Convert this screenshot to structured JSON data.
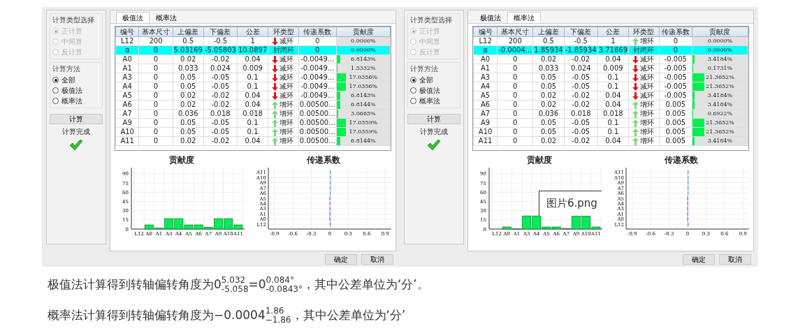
{
  "screenshots": [
    {
      "sidebar": {
        "groups": [
          {
            "title": "计算类型选择",
            "options": [
              {
                "label": "正计算",
                "selected": true,
                "disabled": true
              },
              {
                "label": "中间算",
                "selected": false,
                "disabled": true
              },
              {
                "label": "反计算",
                "selected": false,
                "disabled": true
              }
            ]
          },
          {
            "title": "计算方法",
            "options": [
              {
                "label": "全部",
                "selected": true,
                "disabled": false
              },
              {
                "label": "极值法",
                "selected": false,
                "disabled": false
              },
              {
                "label": "概率法",
                "selected": false,
                "disabled": false
              }
            ]
          }
        ],
        "button": "计算",
        "status": "计算完成",
        "done": true
      },
      "tabs": [
        {
          "label": "极值法",
          "selected": true
        },
        {
          "label": "概率法",
          "selected": false
        }
      ],
      "table": {
        "columns": [
          "编号",
          "基本尺寸",
          "上偏差",
          "下偏差",
          "公差",
          "环类型",
          "传递系数",
          "贡献度"
        ],
        "rows": [
          {
            "cells": [
              "L12",
              "200",
              "0.5",
              "-0.5",
              "1"
            ],
            "kind": "decrease",
            "ring_type": "减环",
            "coefficient": "0",
            "contribution": "0.0000%"
          },
          {
            "cells": [
              "α",
              "0",
              "5.03169",
              "-5.05803",
              "10.0897"
            ],
            "kind": "closed",
            "ring_type": "封闭环",
            "coefficient": "0",
            "contribution": "0.0000%"
          },
          {
            "cells": [
              "A0",
              "0",
              "0.02",
              "-0.02",
              "0.04"
            ],
            "kind": "decrease",
            "ring_type": "减环",
            "coefficient": "-0.0049...",
            "contribution": "6.8143%",
            "level": 0.068
          },
          {
            "cells": [
              "A1",
              "0",
              "0.033",
              "0.024",
              "0.009"
            ],
            "kind": "decrease",
            "ring_type": "减环",
            "coefficient": "-0.0049...",
            "contribution": "1.5332%",
            "level": 0.015
          },
          {
            "cells": [
              "A3",
              "0",
              "0.05",
              "-0.05",
              "0.1"
            ],
            "kind": "decrease",
            "ring_type": "减环",
            "coefficient": "-0.0049...",
            "contribution": "17.0356%",
            "level": 0.17
          },
          {
            "cells": [
              "A4",
              "0",
              "0.05",
              "-0.05",
              "0.1"
            ],
            "kind": "decrease",
            "ring_type": "减环",
            "coefficient": "-0.0049...",
            "contribution": "17.0356%",
            "level": 0.17
          },
          {
            "cells": [
              "A5",
              "0",
              "0.02",
              "-0.02",
              "0.04"
            ],
            "kind": "decrease",
            "ring_type": "减环",
            "coefficient": "-0.0049...",
            "contribution": "6.8143%",
            "level": 0.068
          },
          {
            "cells": [
              "A6",
              "0",
              "0.02",
              "-0.02",
              "0.04"
            ],
            "kind": "increase",
            "ring_type": "增环",
            "coefficient": "0.00500...",
            "contribution": "6.8144%",
            "level": 0.068
          },
          {
            "cells": [
              "A7",
              "0",
              "0.036",
              "0.018",
              "0.018"
            ],
            "kind": "increase",
            "ring_type": "增环",
            "coefficient": "0.00500...",
            "contribution": "3.0665%",
            "level": 0.031
          },
          {
            "cells": [
              "A9",
              "0",
              "0.05",
              "-0.05",
              "0.1"
            ],
            "kind": "increase",
            "ring_type": "增环",
            "coefficient": "0.00500...",
            "contribution": "17.0359%",
            "level": 0.17
          },
          {
            "cells": [
              "A10",
              "0",
              "0.05",
              "-0.05",
              "0.1"
            ],
            "kind": "increase",
            "ring_type": "增环",
            "coefficient": "0.00500...",
            "contribution": "17.0359%",
            "level": 0.17
          },
          {
            "cells": [
              "A11",
              "0",
              "0.02",
              "-0.02",
              "0.04"
            ],
            "kind": "increase",
            "ring_type": "增环",
            "coefficient": "0.00500...",
            "contribution": "6.8144%",
            "level": 0.068
          }
        ]
      },
      "charts": [
        {
          "chart_data": {
            "type": "bar",
            "title": "贡献度",
            "grid": true,
            "categories": [
              "L12",
              "A0",
              "A1",
              "A3",
              "A4",
              "A5",
              "A6",
              "A7",
              "A9",
              "A10",
              "A11"
            ],
            "values": [
              0,
              6.8,
              1.5,
              17,
              17,
              6.8,
              6.8,
              3.1,
              17,
              17,
              6.8
            ],
            "ylim": [
              0,
              100
            ],
            "yticks": [
              0,
              15,
              30,
              45,
              60,
              75,
              90
            ]
          }
        },
        {
          "chart_data": {
            "type": "bar",
            "orientation": "horizontal",
            "title": "传递系数",
            "grid": true,
            "categories": [
              "A11",
              "A10",
              "A9",
              "A7",
              "A6",
              "A5",
              "A4",
              "A3",
              "A1",
              "A0",
              "L12"
            ],
            "series": [
              {
                "color": "#a468d8",
                "values": [
                  null,
                  null,
                  null,
                  null,
                  null,
                  -0.005,
                  -0.005,
                  -0.005,
                  -0.005,
                  -0.005,
                  0
                ]
              },
              {
                "color": "#62a8cc",
                "values": [
                  0.005,
                  0.005,
                  0.005,
                  0.005,
                  0.005,
                  null,
                  null,
                  null,
                  null,
                  null,
                  null
                ]
              }
            ],
            "xlim": [
              -1,
              1
            ],
            "xticks": [
              -0.9,
              -0.6,
              -0.3,
              0,
              0.3,
              0.6,
              0.9
            ]
          }
        }
      ],
      "buttons": [
        "确定",
        "取消"
      ]
    },
    {
      "sidebar": {
        "groups": [
          {
            "title": "计算类型选择",
            "options": [
              {
                "label": "正计算",
                "selected": true,
                "disabled": true
              },
              {
                "label": "中间算",
                "selected": false,
                "disabled": true
              },
              {
                "label": "反计算",
                "selected": false,
                "disabled": true
              }
            ]
          },
          {
            "title": "计算方法",
            "options": [
              {
                "label": "全部",
                "selected": true,
                "disabled": false
              },
              {
                "label": "极值法",
                "selected": false,
                "disabled": false
              },
              {
                "label": "概率法",
                "selected": false,
                "disabled": false
              }
            ]
          }
        ],
        "button": "计算",
        "status": "计算完成",
        "done": true
      },
      "tabs": [
        {
          "label": "极值法",
          "selected": false
        },
        {
          "label": "概率法",
          "selected": true
        }
      ],
      "table": {
        "columns": [
          "编号",
          "基本尺寸",
          "上偏差",
          "下偏差",
          "公差",
          "环类型",
          "传递系数",
          "贡献度"
        ],
        "rows": [
          {
            "cells": [
              "L12",
              "200",
              "0.5",
              "-0.5",
              "1"
            ],
            "kind": "increase",
            "ring_type": "增环",
            "coefficient": "0",
            "contribution": "0.0000%"
          },
          {
            "cells": [
              "α",
              "-0.0004...",
              "1.85934",
              "-1.85934",
              "3.71869"
            ],
            "kind": "closed",
            "ring_type": "封闭环",
            "coefficient": "0",
            "contribution": "0.0000%"
          },
          {
            "cells": [
              "A0",
              "0",
              "0.02",
              "-0.02",
              "0.04"
            ],
            "kind": "decrease",
            "ring_type": "减环",
            "coefficient": "-0.005",
            "contribution": "3.4184%",
            "level": 0.034
          },
          {
            "cells": [
              "A1",
              "0",
              "0.033",
              "0.024",
              "0.009"
            ],
            "kind": "decrease",
            "ring_type": "减环",
            "coefficient": "-0.005",
            "contribution": "0.1731%",
            "level": 0.002
          },
          {
            "cells": [
              "A3",
              "0",
              "0.05",
              "-0.05",
              "0.1"
            ],
            "kind": "decrease",
            "ring_type": "减环",
            "coefficient": "-0.005",
            "contribution": "21.3652%",
            "level": 0.214
          },
          {
            "cells": [
              "A4",
              "0",
              "0.05",
              "-0.05",
              "0.1"
            ],
            "kind": "decrease",
            "ring_type": "减环",
            "coefficient": "-0.005",
            "contribution": "21.3652%",
            "level": 0.214
          },
          {
            "cells": [
              "A5",
              "0",
              "0.02",
              "-0.02",
              "0.04"
            ],
            "kind": "decrease",
            "ring_type": "减环",
            "coefficient": "-0.005",
            "contribution": "3.4184%",
            "level": 0.034
          },
          {
            "cells": [
              "A6",
              "0",
              "0.02",
              "-0.02",
              "0.04"
            ],
            "kind": "increase",
            "ring_type": "增环",
            "coefficient": "0.005",
            "contribution": "3.4184%",
            "level": 0.034
          },
          {
            "cells": [
              "A7",
              "0",
              "0.036",
              "0.018",
              "0.018"
            ],
            "kind": "increase",
            "ring_type": "增环",
            "coefficient": "0.005",
            "contribution": "0.6922%",
            "level": 0.007
          },
          {
            "cells": [
              "A9",
              "0",
              "0.05",
              "-0.05",
              "0.1"
            ],
            "kind": "increase",
            "ring_type": "增环",
            "coefficient": "0.005",
            "contribution": "21.3652%",
            "level": 0.214
          },
          {
            "cells": [
              "A10",
              "0",
              "0.05",
              "-0.05",
              "0.1"
            ],
            "kind": "increase",
            "ring_type": "增环",
            "coefficient": "0.005",
            "contribution": "21.3652%",
            "level": 0.214
          },
          {
            "cells": [
              "A11",
              "0",
              "0.02",
              "-0.02",
              "0.04"
            ],
            "kind": "increase",
            "ring_type": "增环",
            "coefficient": "0.005",
            "contribution": "3.4184%",
            "level": 0.034
          }
        ]
      },
      "charts": [
        {
          "chart_data": {
            "type": "bar",
            "title": "贡献度",
            "grid": true,
            "categories": [
              "L12",
              "A0",
              "A1",
              "A3",
              "A4",
              "A5",
              "A6",
              "A7",
              "A9",
              "A10",
              "A11"
            ],
            "values": [
              0,
              3.4,
              0.2,
              21.4,
              21.4,
              3.4,
              3.4,
              0.7,
              21.4,
              21.4,
              3.4
            ],
            "ylim": [
              0,
              100
            ],
            "yticks": [
              0,
              15,
              30,
              45,
              60,
              75,
              90
            ]
          }
        },
        {
          "chart_data": {
            "type": "bar",
            "orientation": "horizontal",
            "title": "传递系数",
            "grid": true,
            "categories": [
              "A11",
              "A10",
              "A9",
              "A7",
              "A6",
              "A5",
              "A4",
              "A3",
              "A1",
              "A0",
              "L12"
            ],
            "series": [
              {
                "color": "#a468d8",
                "values": [
                  null,
                  null,
                  null,
                  null,
                  null,
                  -0.005,
                  -0.005,
                  -0.005,
                  -0.005,
                  -0.005,
                  0
                ]
              },
              {
                "color": "#62a8cc",
                "values": [
                  0.005,
                  0.005,
                  0.005,
                  0.005,
                  0.005,
                  null,
                  null,
                  null,
                  null,
                  null,
                  null
                ]
              }
            ],
            "xlim": [
              -1,
              1
            ],
            "xticks": [
              -0.9,
              -0.6,
              -0.3,
              0,
              0.3,
              0.6,
              0.9
            ]
          }
        }
      ],
      "buttons": [
        "确定",
        "取消"
      ]
    }
  ],
  "tooltip": {
    "text": "图片6.png"
  },
  "paragraphs": [
    "极值法计算得到转轴偏转角度为0$^{5.032}$$_{-5.058}$=0$^{0.084°}$$_{-0.0843°}$，其中公差单位为‘分’。",
    "概率法计算得到转轴偏转角度为−0.0004$^{1.86}$$_{−1.86}$，其中公差单位为‘分’"
  ]
}
